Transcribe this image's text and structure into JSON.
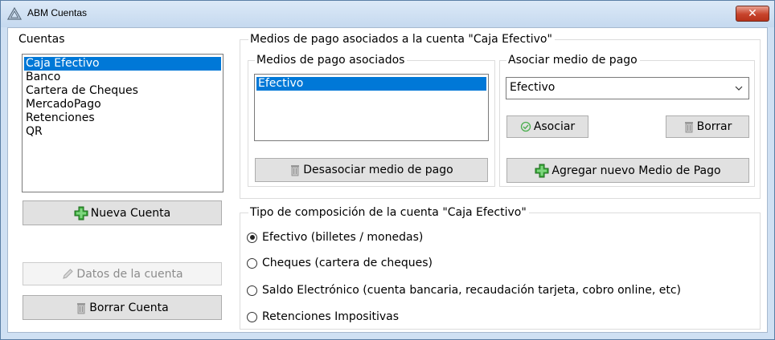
{
  "window": {
    "title": "ABM Cuentas",
    "close_label": "✕"
  },
  "cuentas": {
    "group_label": "Cuentas",
    "items": [
      {
        "label": "Caja Efectivo",
        "selected": true
      },
      {
        "label": "Banco",
        "selected": false
      },
      {
        "label": "Cartera de Cheques",
        "selected": false
      },
      {
        "label": "MercadoPago",
        "selected": false
      },
      {
        "label": "Retenciones",
        "selected": false
      },
      {
        "label": "QR",
        "selected": false
      }
    ],
    "nueva_label": "Nueva Cuenta",
    "datos_label": "Datos de la cuenta",
    "borrar_label": "Borrar Cuenta"
  },
  "medios": {
    "group_label": "Medios de pago asociados a la cuenta \"Caja Efectivo\"",
    "asociados": {
      "group_label": "Medios de pago asociados",
      "items": [
        {
          "label": "Efectivo",
          "selected": true
        }
      ],
      "desasociar_label": "Desasociar medio de pago"
    },
    "asociar": {
      "group_label": "Asociar medio de pago",
      "selected_value": "Efectivo",
      "asociar_label": "Asociar",
      "borrar_label": "Borrar",
      "agregar_label": "Agregar nuevo Medio de Pago"
    }
  },
  "tipo": {
    "group_label": "Tipo de composición de la cuenta \"Caja Efectivo\"",
    "options": [
      {
        "label": "Efectivo (billetes / monedas)",
        "checked": true
      },
      {
        "label": "Cheques (cartera de cheques)",
        "checked": false
      },
      {
        "label": "Saldo Electrónico (cuenta bancaria, recaudación tarjeta, cobro online, etc)",
        "checked": false
      },
      {
        "label": "Retenciones Impositivas",
        "checked": false
      }
    ]
  },
  "icons": {
    "app": "triangle-logo-icon",
    "add": "green-plus-icon",
    "edit": "pencil-icon",
    "delete": "trash-can-icon",
    "check": "check-circle-icon",
    "dropdown": "chevron-down-icon"
  },
  "colors": {
    "selection": "#0078d7",
    "add_green": "#3aa83a",
    "check_green": "#4caf50"
  }
}
